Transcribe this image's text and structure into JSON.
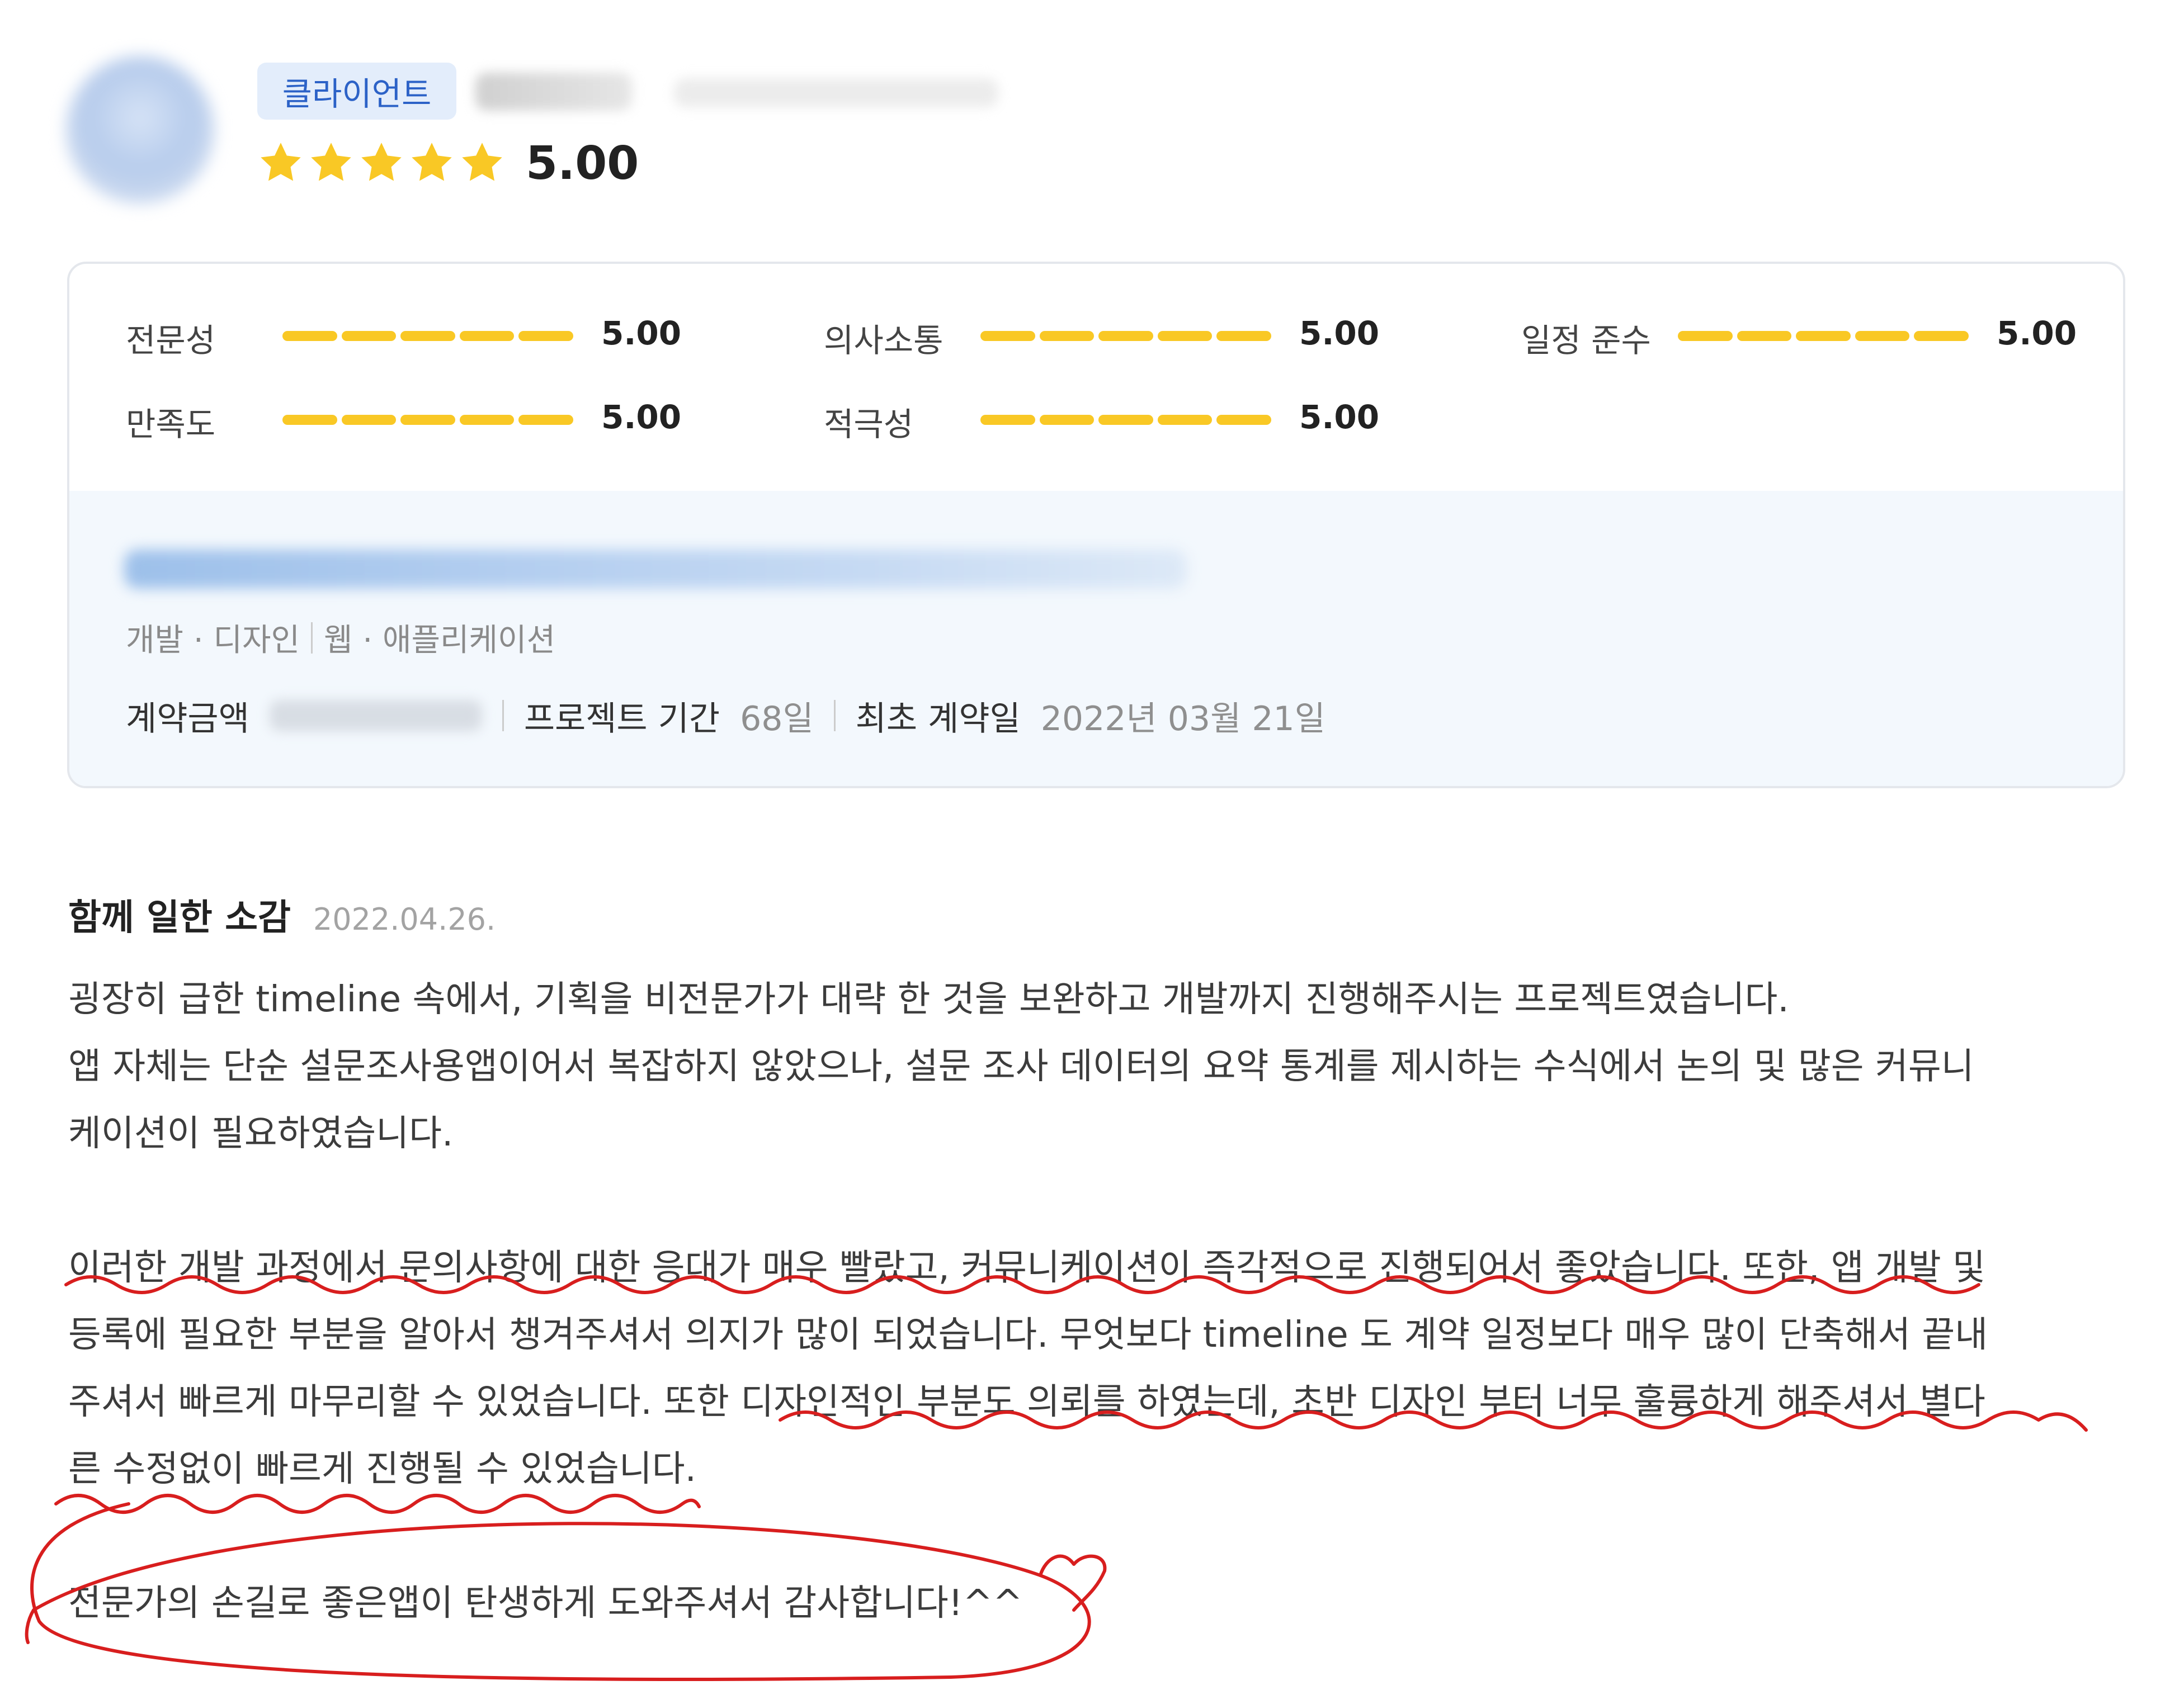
{
  "header": {
    "badge": "클라이언트",
    "rating": "5.00",
    "star_count": 5,
    "star_color": "#f9c825"
  },
  "metrics": [
    {
      "label": "전문성",
      "value": "5.00"
    },
    {
      "label": "의사소통",
      "value": "5.00"
    },
    {
      "label": "일정 준수",
      "value": "5.00"
    },
    {
      "label": "만족도",
      "value": "5.00"
    },
    {
      "label": "적극성",
      "value": "5.00"
    }
  ],
  "project": {
    "category_1": "개발 · 디자인",
    "category_2": "웹 · 애플리케이션",
    "amount_label": "계약금액",
    "period_label": "프로젝트 기간",
    "period_value": "68일",
    "contract_date_label": "최초 계약일",
    "contract_date_value": "2022년 03월 21일"
  },
  "review": {
    "title": "함께 일한 소감",
    "date": "2022.04.26.",
    "lines": [
      "굉장히 급한 timeline 속에서, 기획을 비전문가가 대략 한 것을 보완하고 개발까지 진행해주시는 프로젝트였습니다.",
      "앱 자체는 단순 설문조사용앱이어서 복잡하지 않았으나, 설문 조사 데이터의 요약 통계를 제시하는 수식에서 논의 및 많은 커뮤니",
      "케이션이 필요하였습니다.",
      "이러한 개발 과정에서 문의사항에 대한 응대가 매우 빨랐고, 커뮤니케이션이 즉각적으로 진행되어서 좋았습니다. 또한, 앱 개발 및",
      "등록에 필요한 부분을 알아서 챙겨주셔서 의지가 많이 되었습니다. 무엇보다 timeline 도 계약 일정보다 매우 많이 단축해서 끝내",
      "주셔서 빠르게 마무리할 수 있었습니다. 또한 디자인적인 부분도 의뢰를 하였는데, 초반 디자인 부터 너무 훌륭하게 해주셔서 별다",
      "른 수정없이 빠르게 진행될 수 있었습니다.",
      "전문가의 손길로 좋은앱이 탄생하게 도와주셔서 감사합니다!^^"
    ]
  },
  "colors": {
    "bar": "#f9c825",
    "badge_bg": "#e3edfb",
    "badge_text": "#2c62c7",
    "annotation": "#d81e1e"
  }
}
